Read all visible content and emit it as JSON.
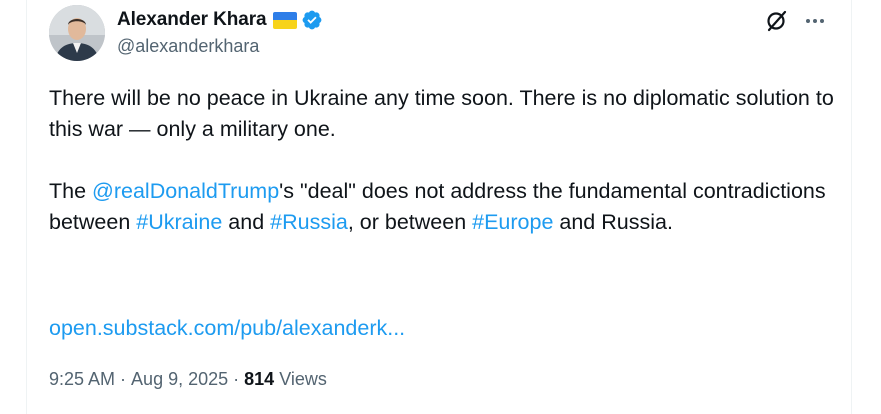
{
  "author": {
    "name": "Alexander Khara",
    "handle": "@alexanderkhara",
    "avatar_icon": "profile-photo",
    "flag_icon": "ukraine-flag",
    "verified_icon": "verified-badge",
    "verified_color": "#1d9bf0"
  },
  "actions": {
    "grok_icon": "grok-icon",
    "more_icon": "more-icon"
  },
  "tweet": {
    "p1": "There will be no peace in Ukraine any time soon. There is no diplomatic solution to this war — only a military one.",
    "p2_before_mention": "The ",
    "mention": "@realDonaldTrump",
    "p2_after_mention": "'s \"deal\" does not address the fundamental contradictions between ",
    "hashtag_ukraine": "#Ukraine",
    "and_1": " and ",
    "hashtag_russia": "#Russia",
    "or_between": ", or between ",
    "hashtag_europe": "#Europe",
    "and_russia": " and Russia.",
    "link": "open.substack.com/pub/alexanderk..."
  },
  "meta": {
    "time": "9:25 AM",
    "separator": "·",
    "date": "Aug 9, 2025",
    "views_count": "814",
    "views_label": "Views"
  },
  "colors": {
    "link": "#1d9bf0",
    "text": "#0f1419",
    "secondary": "#536471"
  }
}
